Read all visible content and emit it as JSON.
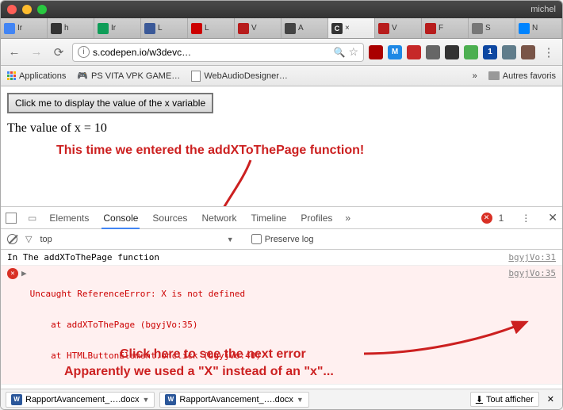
{
  "titlebar": {
    "user": "michel"
  },
  "tabs": [
    {
      "label": "Ir",
      "color": "#4285f4"
    },
    {
      "label": "h",
      "color": "#333"
    },
    {
      "label": "Ir",
      "color": "#0f9d58"
    },
    {
      "label": "L",
      "color": "#3b5998"
    },
    {
      "label": "L",
      "color": "#cc0000"
    },
    {
      "label": "V",
      "color": "#b71c1c"
    },
    {
      "label": "A",
      "color": "#444"
    },
    {
      "label": "×",
      "color": "#333",
      "active": true,
      "prefix": "C"
    },
    {
      "label": "V",
      "color": "#b71c1c"
    },
    {
      "label": "F",
      "color": "#b71c1c"
    },
    {
      "label": "S",
      "color": "#777"
    },
    {
      "label": "N",
      "color": "#0084ff"
    }
  ],
  "address": {
    "url": "s.codepen.io/w3devc…",
    "extensions": [
      {
        "bg": "#a00",
        "txt": ""
      },
      {
        "bg": "#1e88e5",
        "txt": "M"
      },
      {
        "bg": "#c62828",
        "txt": ""
      },
      {
        "bg": "#666",
        "txt": ""
      },
      {
        "bg": "#333",
        "txt": ""
      },
      {
        "bg": "#4caf50",
        "txt": ""
      },
      {
        "bg": "#0d47a1",
        "txt": "1"
      },
      {
        "bg": "#607d8b",
        "txt": ""
      },
      {
        "bg": "#795548",
        "txt": ""
      }
    ]
  },
  "bookmarks": {
    "apps": "Applications",
    "item1": "PS VITA VPK GAME…",
    "item2": "WebAudioDesigner…",
    "more": "»",
    "other": "Autres favoris"
  },
  "page": {
    "button": "Click me to display the value of the x variable",
    "output": "The value of x = 10"
  },
  "annotations": {
    "a1": "This time we entered the addXToThePage function!",
    "a2": "Click here to see the next error",
    "a3": "Apparently we used a \"X\" instead of an \"x\"..."
  },
  "devtools": {
    "tabs": [
      "Elements",
      "Console",
      "Sources",
      "Network",
      "Timeline",
      "Profiles"
    ],
    "moreGlyph": "»",
    "errCount": "1",
    "filter_scope": "top",
    "filter_arrow": "▼",
    "preserve": "Preserve log",
    "log1": {
      "text": "In The addXToThePage function",
      "src": "bgyjVo:31"
    },
    "error": {
      "line1": "Uncaught ReferenceError: X is not defined",
      "line2": "    at addXToThePage (bgyjVo:35)",
      "line3": "    at HTMLButtonElement.onclick (bgyjVo:40)",
      "src": "bgyjVo:35"
    },
    "prompt": "›"
  },
  "downloads": {
    "file1": "RapportAvancement_….docx",
    "file2": "RapportAvancement_….docx",
    "showall": "Tout afficher"
  }
}
